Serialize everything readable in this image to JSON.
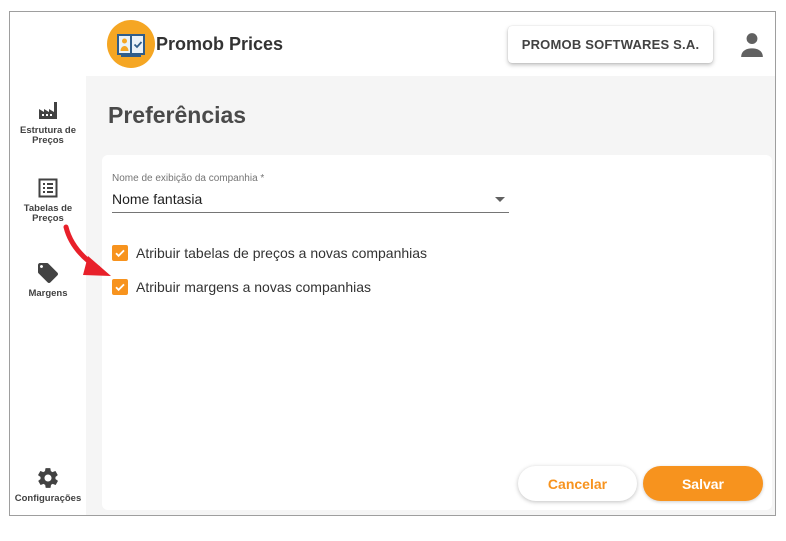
{
  "app": {
    "title": "Promob Prices"
  },
  "header": {
    "company_button": "PROMOB SOFTWARES S.A."
  },
  "sidebar": {
    "items": [
      {
        "label": "Estrutura de Preços",
        "icon": "factory-icon"
      },
      {
        "label": "Tabelas de Preços",
        "icon": "list-icon"
      },
      {
        "label": "Margens",
        "icon": "tag-icon"
      },
      {
        "label": "Configurações",
        "icon": "gear-icon"
      }
    ]
  },
  "main": {
    "title": "Preferências",
    "form": {
      "display_name_label": "Nome de exibição da companhia *",
      "display_name_value": "Nome fantasia",
      "checkboxes": [
        {
          "label": "Atribuir tabelas de preços a novas companhias",
          "checked": true
        },
        {
          "label": "Atribuir margens a novas companhias",
          "checked": true
        }
      ]
    },
    "buttons": {
      "cancel": "Cancelar",
      "save": "Salvar"
    }
  },
  "colors": {
    "accent": "#f7931e",
    "logo": "#f5a623",
    "annotation_arrow": "#e8202a"
  }
}
